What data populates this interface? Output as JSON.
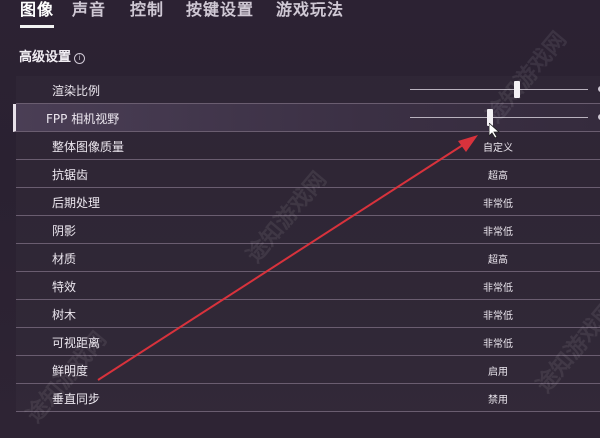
{
  "tabs": [
    {
      "label": "图像",
      "active": true
    },
    {
      "label": "声音",
      "active": false
    },
    {
      "label": "控制",
      "active": false
    },
    {
      "label": "按键设置",
      "active": false
    },
    {
      "label": "游戏玩法",
      "active": false
    }
  ],
  "section_title": "高级设置",
  "info_glyph": "i",
  "rows": [
    {
      "label": "渲染比例",
      "type": "slider",
      "level": 0.6
    },
    {
      "label": "FPP 相机视野",
      "type": "slider",
      "level": 0.45,
      "highlighted": true
    },
    {
      "label": "整体图像质量",
      "value": "自定义"
    },
    {
      "label": "抗锯齿",
      "value": "超高"
    },
    {
      "label": "后期处理",
      "value": "非常低"
    },
    {
      "label": "阴影",
      "value": "非常低"
    },
    {
      "label": "材质",
      "value": "超高"
    },
    {
      "label": "特效",
      "value": "非常低"
    },
    {
      "label": "树木",
      "value": "非常低"
    },
    {
      "label": "可视距离",
      "value": "非常低"
    },
    {
      "label": "鲜明度",
      "value": "启用"
    },
    {
      "label": "垂直同步",
      "value": "禁用"
    }
  ],
  "watermark": "途知游戏网",
  "colors": {
    "arrow": "#d8323c",
    "background": "#2c2233",
    "highlight": "#4a3e55"
  }
}
